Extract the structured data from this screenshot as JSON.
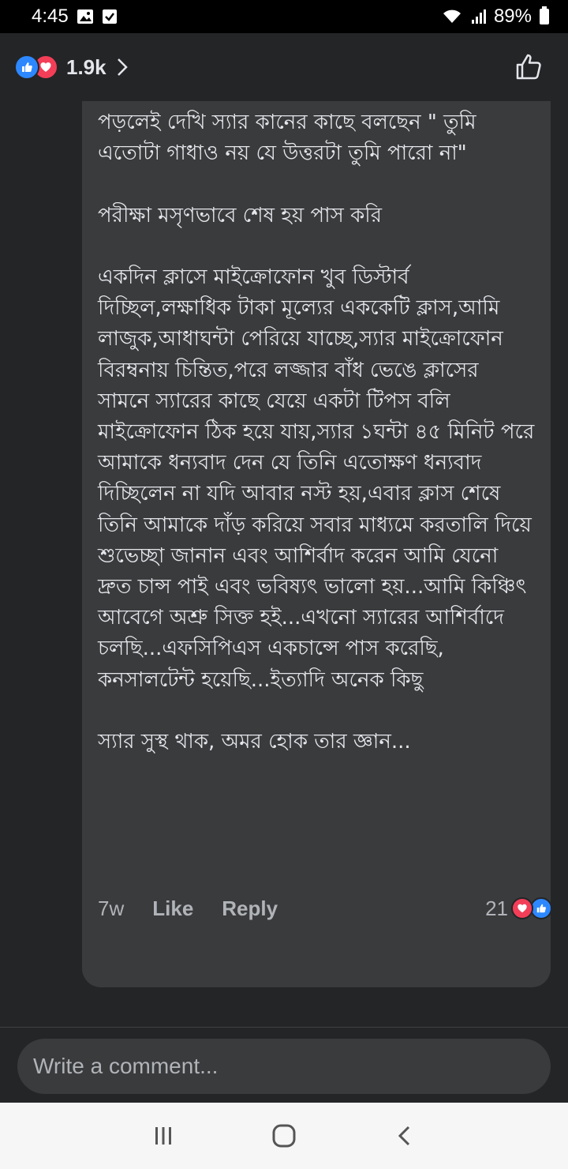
{
  "status_bar": {
    "time": "4:45",
    "battery": "89%"
  },
  "header": {
    "reaction_count": "1.9k"
  },
  "comment": {
    "paragraphs": [
      "পড়লেই দেখি স্যার কানের কাছে বলছেন \" তুমি এতোটা গাধাও নয় যে উত্তরটা তুমি পারো না\"",
      "পরীক্ষা মসৃণভাবে শেষ হয় পাস করি",
      "একদিন ক্লাসে মাইক্রোফোন খুব ডিস্টার্ব দিচ্ছিল,লক্ষাধিক টাকা মূল্যের এককেটি ক্লাস,আমি লাজুক,আধাঘন্টা পেরিয়ে যাচ্ছে,স্যার মাইক্রোফোন বিরম্বনায় চিন্তিত,পরে লজ্জার বাঁধ ভেঙে ক্লাসের সামনে স্যারের কাছে যেয়ে একটা টিপস বলি মাইক্রোফোন ঠিক হয়ে যায়,স্যার ১ঘন্টা ৪৫ মিনিট পরে আমাকে ধন্যবাদ দেন যে তিনি এতোক্ষণ ধন্যবাদ দিচ্ছিলেন না যদি আবার নস্ট হয়,এবার ক্লাস শেষে তিনি আমাকে দাঁড় করিয়ে সবার মাধ্যমে করতালি দিয়ে শুভেচ্ছা জানান এবং আশির্বাদ করেন আমি যেনো দ্রুত চান্স পাই এবং ভবিষ্যৎ ভালো হয়...আমি কিঞ্চিৎ আবেগে অশ্রু সিক্ত হই...এখনো স্যারের আশির্বাদে চলছি...এফসিপিএস একচান্সে পাস করেছি, কনসালটেন্ট হয়েছি...ইত্যাদি অনেক কিছু",
      "স্যার সুস্থ থাক, অমর হোক তার জ্ঞান..."
    ],
    "time": "7w",
    "like_label": "Like",
    "reply_label": "Reply",
    "reaction_count": "21"
  },
  "composer": {
    "placeholder": "Write a comment..."
  },
  "icons": {
    "gallery": "gallery-icon",
    "check": "checkbox-icon",
    "wifi": "wifi-icon",
    "signal": "signal-icon",
    "battery": "battery-icon",
    "like_reaction": "like-reaction-icon",
    "love_reaction": "love-reaction-icon",
    "chevron": "chevron-right-icon",
    "thumbs_up": "thumbs-up-icon",
    "recents": "recents-icon",
    "home": "home-icon",
    "back": "back-icon"
  },
  "colors": {
    "like_blue": "#2d88ff",
    "love_red": "#f33e58",
    "bubble": "#3a3b3c",
    "surface": "#242526"
  }
}
